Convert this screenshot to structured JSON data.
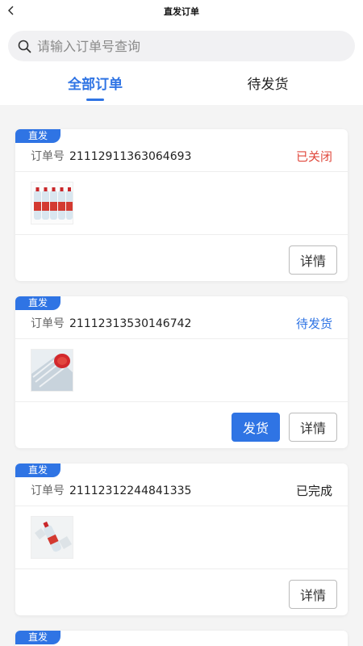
{
  "nav": {
    "title": "直发订单",
    "back_icon": "chevron-left-icon"
  },
  "search": {
    "placeholder": "请输入订单号查询",
    "value": "",
    "icon": "search-icon"
  },
  "tabs": [
    {
      "label": "全部订单",
      "active": true
    },
    {
      "label": "待发货",
      "active": false
    }
  ],
  "colors": {
    "accent": "#2f74e4",
    "status_closed": "#e0483c",
    "status_pending": "#2f74e4",
    "status_done": "#222222"
  },
  "orders": [
    {
      "tag": "直发",
      "order_label": "订单号",
      "order_no": "21112911363064693",
      "status": "已关闭",
      "thumb": "water-bottle-pack-image",
      "buttons": {
        "detail": "详情"
      }
    },
    {
      "tag": "直发",
      "order_label": "订单号",
      "order_no": "21112313530146742",
      "status": "待发货",
      "thumb": "bottle-closeup-image",
      "buttons": {
        "ship": "发货",
        "detail": "详情"
      }
    },
    {
      "tag": "直发",
      "order_label": "订单号",
      "order_no": "21112312244841335",
      "status": "已完成",
      "thumb": "single-bottle-image",
      "buttons": {
        "detail": "详情"
      }
    },
    {
      "tag": "直发"
    }
  ]
}
